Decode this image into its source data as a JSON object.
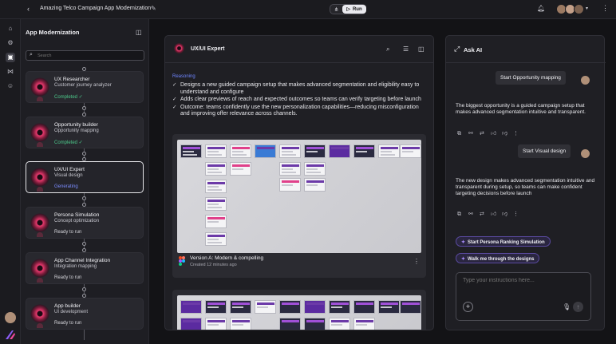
{
  "topbar": {
    "project_title": "Amazing Telco Campaign App Modernization",
    "run_label": "Run"
  },
  "sidebar": {
    "title": "App Modernization",
    "search_placeholder": "Search",
    "steps": [
      {
        "title": "UX Researcher",
        "subtitle": "Customer journey analyzer",
        "status": "Completed ✓",
        "state": "completed"
      },
      {
        "title": "Opportunity builder",
        "subtitle": "Opportunity mapping",
        "status": "Completed ✓",
        "state": "completed"
      },
      {
        "title": "UX/UI Expert",
        "subtitle": "Visual design",
        "status": "Generating",
        "state": "generating"
      },
      {
        "title": "Persona Simulation",
        "subtitle": "Concept optimization",
        "status": "Ready to run",
        "state": "ready"
      },
      {
        "title": "App Channel Integration",
        "subtitle": "Integration mapping",
        "status": "Ready to run",
        "state": "ready"
      },
      {
        "title": "App builder",
        "subtitle": "UI development",
        "status": "Ready to run",
        "state": "ready"
      }
    ]
  },
  "center": {
    "title": "UX/UI Expert",
    "reasoning_label": "Reasoning",
    "bullets": [
      "Designs a new guided campaign setup that makes advanced segmentation and eligibility easy to understand and configure",
      "Adds clear previews of reach and expected outcomes so teams can verify targeting before launch",
      "Outcome: teams confidently use the new personalization capabilities—reducing misconfiguration and improving offer relevance across channels."
    ],
    "version_title": "Version A: Modern & compelling",
    "version_sub": "Created 12 minutes ago"
  },
  "ask_ai": {
    "title": "Ask AI",
    "messages": [
      {
        "role": "user",
        "text": "Start Opportunity mapping"
      },
      {
        "role": "ai",
        "text": "The biggest opportunity is a guided campaign setup that makes advanced segmentation intuitive and transparent."
      },
      {
        "role": "user",
        "text": "Start Visual design"
      },
      {
        "role": "ai",
        "text": "The new design makes advanced segmentation intuitive and transparent during setup, so teams can make confident targeting decisions before launch"
      }
    ],
    "suggestions": [
      "Start Persona Ranking Simulation",
      "Walk me through the designs"
    ],
    "composer_placeholder": "Type your instructions here..."
  },
  "colors": {
    "accent_blue": "#6f86ff",
    "completed_green": "#4cc98a",
    "orb_pink": "#e83a6e"
  }
}
